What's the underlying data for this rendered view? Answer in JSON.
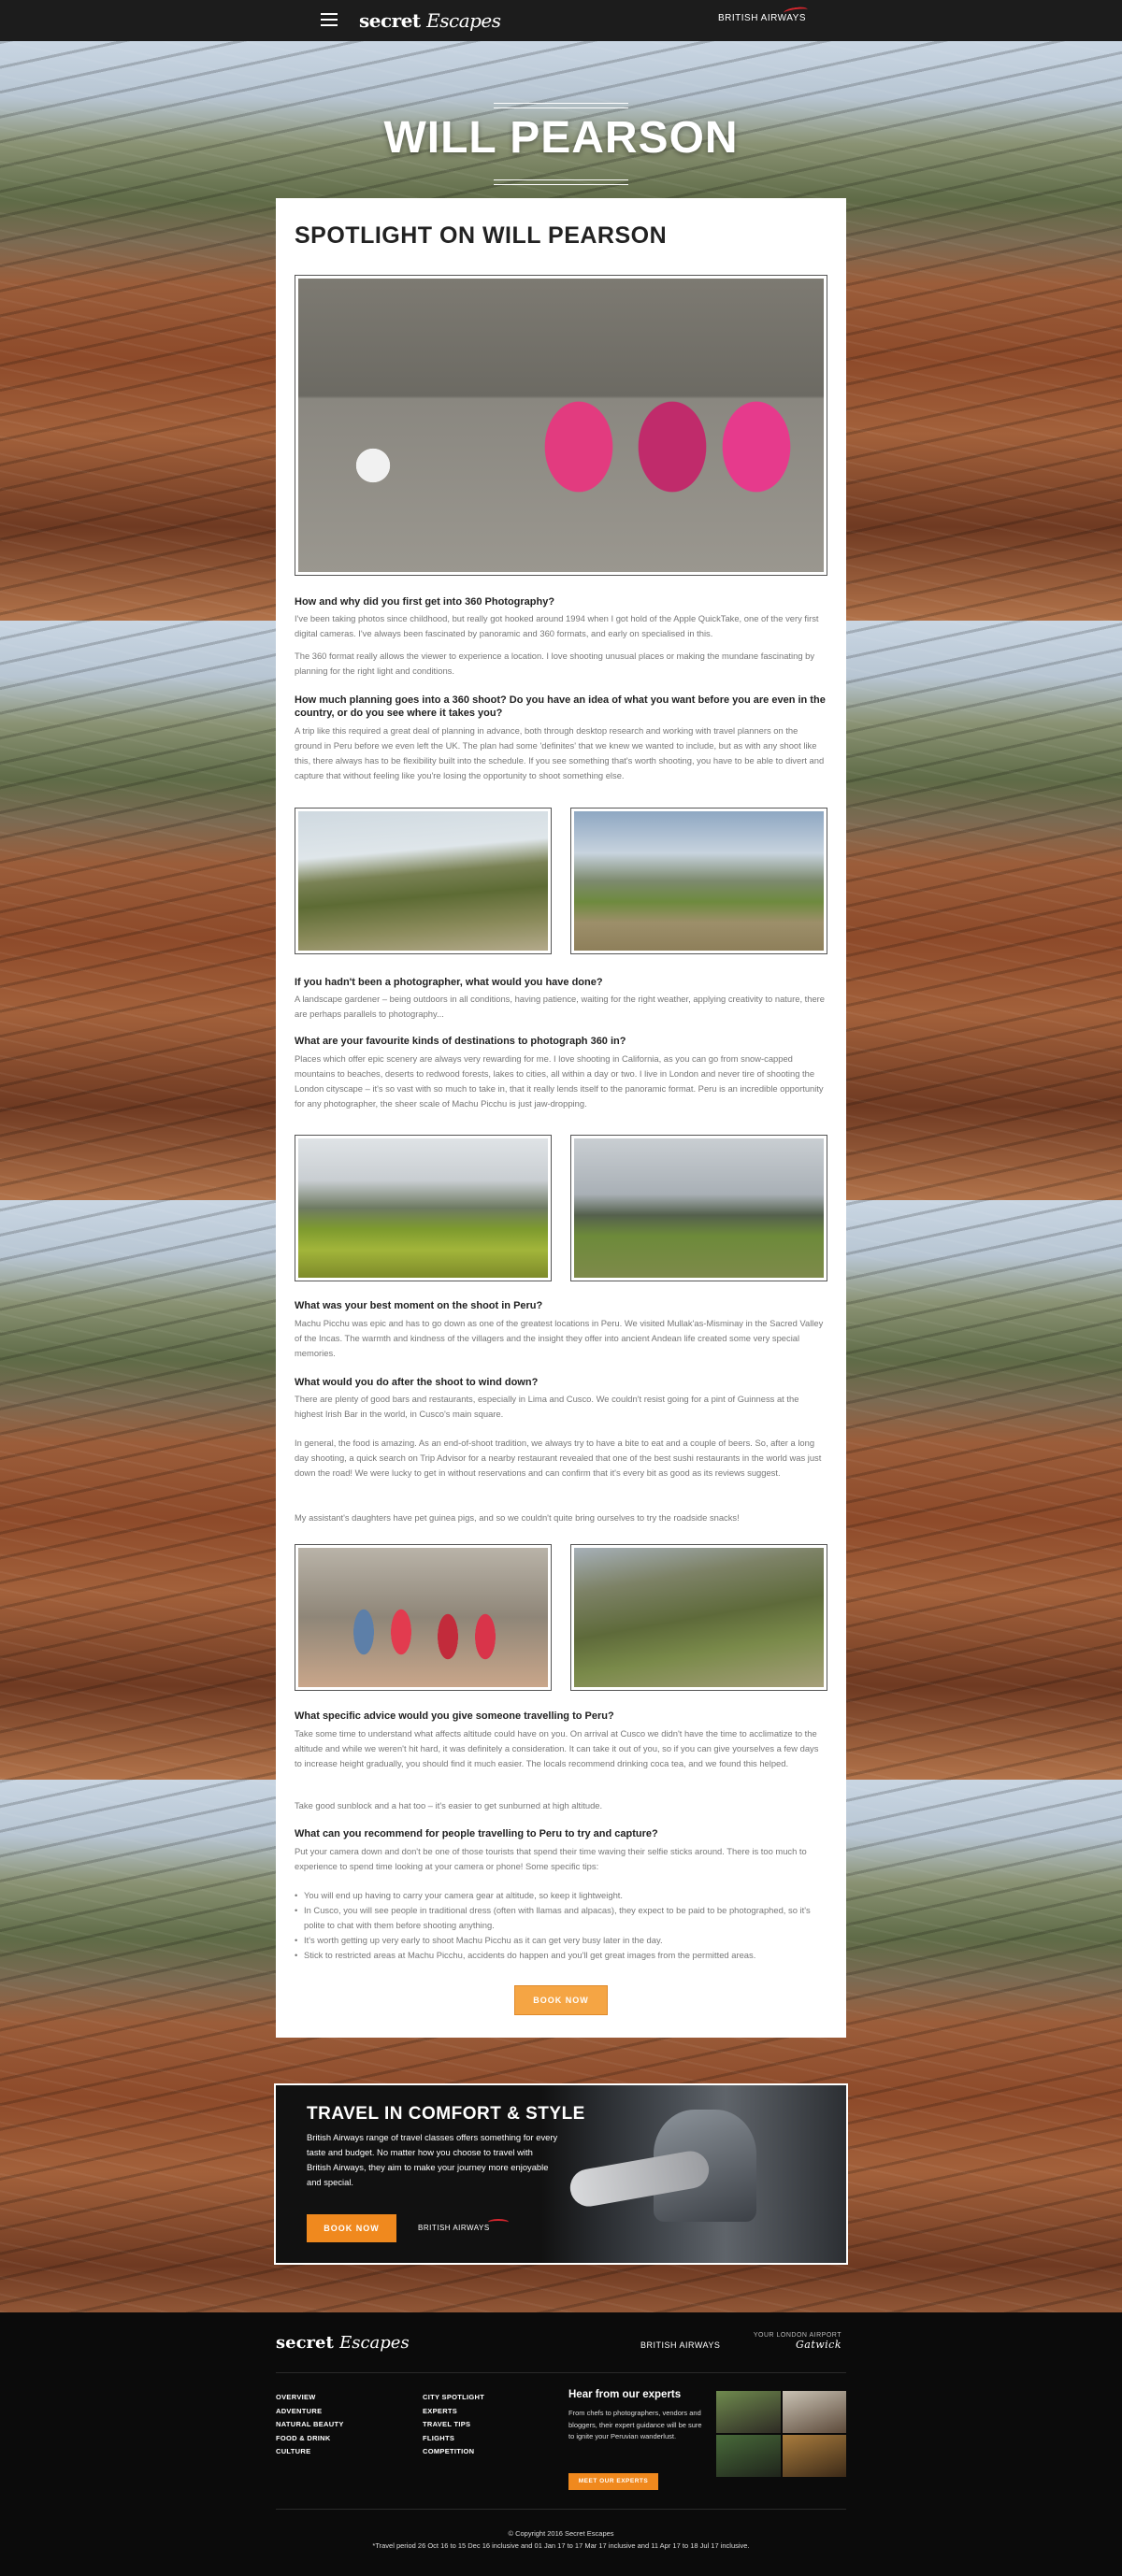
{
  "nav": {
    "brand_bold": "secret",
    "brand_light": "Escapes",
    "partner": "BRITISH AIRWAYS"
  },
  "hero": {
    "title": "WILL PEARSON"
  },
  "article": {
    "heading": "SPOTLIGHT ON WILL PEARSON",
    "sections": [
      {
        "q": "How and why did you first get into 360 Photography?",
        "p": [
          "I've been taking photos since childhood, but really got hooked around 1994 when I got hold of the Apple QuickTake, one of the very first digital cameras. I've always been fascinated by panoramic and 360 formats, and early on specialised in this.",
          "The 360 format really allows the viewer to experience a location. I love shooting unusual places or making the mundane fascinating by planning for the right light and conditions."
        ]
      },
      {
        "q": "How much planning goes into a 360 shoot? Do you have an idea of what you want before you are even in the country, or do you see where it takes you?",
        "p": [
          "A trip like this required a great deal of planning in advance, both through desktop research and working with travel planners on the ground in Peru before we even left the UK. The plan had some 'definites' that we knew we wanted to include, but as with any shoot like this, there always has to be flexibility built into the schedule. If you see something that's worth shooting, you have to be able to divert and capture that without feeling like you're losing the opportunity to shoot something else."
        ]
      },
      {
        "q": "If you hadn't been a photographer, what would you have done?",
        "p": [
          "A landscape gardener – being outdoors in all conditions, having patience, waiting for the right weather, applying creativity to nature, there are perhaps parallels to photography..."
        ]
      },
      {
        "q": "What are your favourite kinds of destinations to photograph 360 in?",
        "p": [
          "Places which offer epic scenery are always very rewarding for me. I love shooting in California, as you can go from snow-capped mountains to beaches, deserts to redwood forests, lakes to cities, all within a day or two. I live in London and never tire of shooting the London cityscape – it's so vast with so much to take in, that it really lends itself to the panoramic format. Peru is an incredible opportunity for any photographer, the sheer scale of Machu Picchu is just jaw-dropping."
        ]
      },
      {
        "q": "What was your best moment on the shoot in Peru?",
        "p": [
          "Machu Picchu was epic and has to go down as one of the greatest locations in Peru. We visited Mullak'as-Misminay in the Sacred Valley of the Incas. The warmth and kindness of the villagers and the insight they offer into ancient Andean life created some very special memories."
        ]
      },
      {
        "q": "What would you do after the shoot to wind down?",
        "p": [
          "There are plenty of good bars and restaurants, especially in Lima and Cusco. We couldn't resist going for a pint of Guinness at the highest Irish Bar in the world, in Cusco's main square.",
          "In general, the food is amazing. As an end-of-shoot tradition, we always try to have a bite to eat and a couple of beers. So, after a long day shooting, a quick search on Trip Advisor for a nearby restaurant revealed that one of the best sushi restaurants in the world was just down the road! We were lucky to get in without reservations and can confirm that it's every bit as good as its reviews suggest.",
          "My assistant's daughters have pet guinea pigs, and so we couldn't quite bring ourselves to try the roadside snacks!"
        ]
      },
      {
        "q": "What specific advice would you give someone travelling to Peru?",
        "p": [
          "Take some time to understand what affects altitude could have on you. On arrival at Cusco we didn't have the time to acclimatize to the altitude and while we weren't hit hard, it was definitely a consideration. It can take it out of you, so if you can give yourselves a few days to increase height gradually, you should find it much easier. The locals recommend drinking coca tea, and we found this helped.",
          "Take good sunblock and a hat too – it's easier to get sunburned at high altitude."
        ]
      },
      {
        "q": "What can you recommend for people travelling to Peru to try and capture?",
        "p": [
          "Put your camera down and don't be one of those tourists that spend their time waving their selfie sticks around. There is too much to experience to spend time looking at your camera or phone! Some specific tips:"
        ]
      }
    ],
    "tips": [
      "You will end up having to carry your camera gear at altitude, so keep it lightweight.",
      "In Cusco, you will see people in traditional dress (often with llamas and alpacas), they expect to be paid to be photographed, so it's polite to chat with them before shooting anything.",
      "It's worth getting up very early to shoot Machu Picchu as it can get very busy later in the day.",
      "Stick to restricted areas at Machu Picchu, accidents do happen and you'll get great images from the permitted areas."
    ],
    "book_label": "BOOK NOW"
  },
  "banner": {
    "title": "TRAVEL IN COMFORT & STYLE",
    "text": "British Airways range of travel classes offers something for every taste and budget. No matter how you choose to travel with British Airways, they aim to make your journey more enjoyable and special.",
    "button": "BOOK NOW",
    "partner": "BRITISH AIRWAYS"
  },
  "footer": {
    "brand_bold": "secret",
    "brand_light": "Escapes",
    "partner": "BRITISH AIRWAYS",
    "airport_line": "YOUR LONDON AIRPORT",
    "airport_name": "Gatwick",
    "col1": [
      "OVERVIEW",
      "ADVENTURE",
      "NATURAL BEAUTY",
      "FOOD & DRINK",
      "CULTURE"
    ],
    "col2": [
      "CITY SPOTLIGHT",
      "EXPERTS",
      "TRAVEL TIPS",
      "FLIGHTS",
      "COMPETITION"
    ],
    "experts_title": "Hear from our experts",
    "experts_text": "From chefs to photographers, vendors and bloggers, their expert guidance will be sure to ignite your Peruvian wanderlust.",
    "experts_button": "MEET OUR EXPERTS",
    "copyright": "© Copyright 2016 Secret Escapes",
    "terms": "*Travel period 26 Oct 16 to 15 Dec 16 inclusive and 01 Jan 17 to 17 Mar 17 inclusive and 11 Apr 17 to 18 Jul 17 inclusive."
  },
  "colors": {
    "accent": "#f5a544",
    "ba_red": "#d7262e",
    "dark": "#1c1c1c"
  }
}
